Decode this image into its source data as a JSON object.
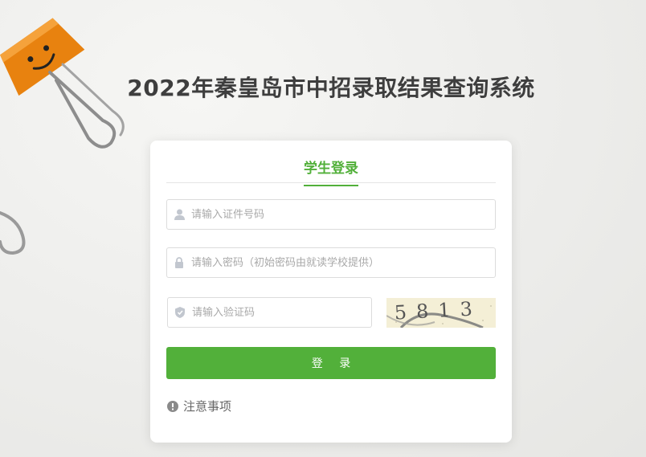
{
  "page": {
    "title": "2022年秦皇岛市中招录取结果查询系统"
  },
  "login_card": {
    "tab_label": "学生登录",
    "id_field": {
      "placeholder": "请输入证件号码",
      "value": "",
      "icon": "user-icon"
    },
    "password_field": {
      "placeholder": "请输入密码（初始密码由就读学校提供）",
      "value": "",
      "icon": "lock-icon"
    },
    "captcha_field": {
      "placeholder": "请输入验证码",
      "value": "",
      "icon": "shield-icon"
    },
    "captcha_image": {
      "text": "5813"
    },
    "login_button": "登 录",
    "notice_link": {
      "label": "注意事项",
      "icon": "info-icon"
    }
  },
  "colors": {
    "accent": "#52b03a",
    "title": "#3e3e3e",
    "clip": "#e8820f"
  }
}
